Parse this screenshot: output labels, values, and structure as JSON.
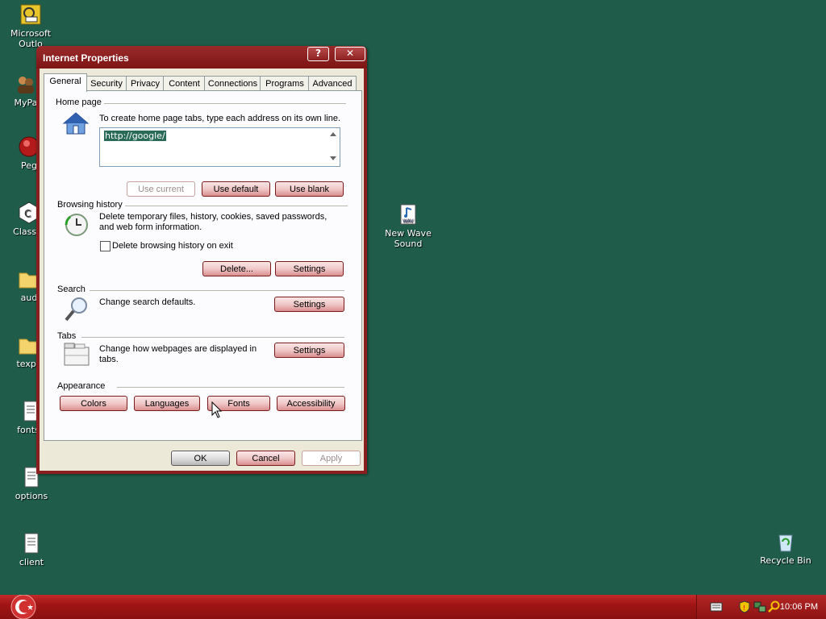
{
  "desktop": {
    "icons": [
      {
        "label": "Microsoft Outlo...",
        "label1": "Microsoft",
        "label2": "Outlo"
      },
      {
        "label": "MyPa"
      },
      {
        "label": "Peg"
      },
      {
        "label": "ClassiC"
      },
      {
        "label": "aud"
      },
      {
        "label": "texpa"
      },
      {
        "label": "fontsc"
      },
      {
        "label": "options"
      },
      {
        "label": "client"
      },
      {
        "label1": "New Wave",
        "label2": "Sound"
      },
      {
        "label": "Recycle Bin"
      }
    ]
  },
  "dialog": {
    "title": "Internet Properties",
    "help_label": "?",
    "close_label": "✕",
    "tabs": [
      "General",
      "Security",
      "Privacy",
      "Content",
      "Connections",
      "Programs",
      "Advanced"
    ],
    "active_tab": "General",
    "home_page": {
      "heading": "Home page",
      "instruction": "To create home page tabs, type each address on its own line.",
      "value": "http://google/",
      "use_current": "Use current",
      "use_default": "Use default",
      "use_blank": "Use blank"
    },
    "browsing_history": {
      "heading": "Browsing history",
      "description_line1": "Delete temporary files, history, cookies, saved passwords,",
      "description_line2": "and web form information.",
      "checkbox_label": "Delete browsing history on exit",
      "checkbox_checked": false,
      "delete_button": "Delete...",
      "settings_button": "Settings"
    },
    "search": {
      "heading": "Search",
      "description": "Change search defaults.",
      "settings_button": "Settings"
    },
    "tabs_section": {
      "heading": "Tabs",
      "description_line1": "Change how webpages are displayed in",
      "description_line2": "tabs.",
      "settings_button": "Settings"
    },
    "appearance": {
      "heading": "Appearance",
      "colors": "Colors",
      "languages": "Languages",
      "fonts": "Fonts",
      "accessibility": "Accessibility"
    },
    "footer": {
      "ok": "OK",
      "cancel": "Cancel",
      "apply": "Apply"
    }
  },
  "taskbar": {
    "clock": "10:06 PM"
  },
  "colors": {
    "desktop": "#1f5c49",
    "window_frame": "#8a1f1f",
    "taskbar": "#a01515",
    "selection": "#2a6b57"
  }
}
